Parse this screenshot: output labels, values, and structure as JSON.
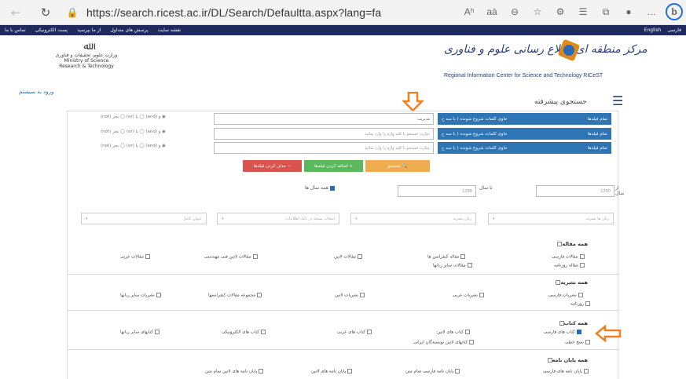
{
  "browser": {
    "url": "https://search.ricest.ac.ir/DL/Search/Defaultta.aspx?lang=fa",
    "zoom": "Aʰ",
    "read": "aà"
  },
  "topnav": {
    "left": [
      "تماس با ما",
      "پست الکترونیکی",
      "از ما بپرسید",
      "پرسش های متداول",
      "نقشه سایت"
    ],
    "right": [
      "English",
      "فارسی"
    ]
  },
  "header": {
    "center_fa": "مرکز منطقه ای اطلاع رسانی علوم و فناوری",
    "center_en": "Regional Information Center for Science and Technology  RICeST",
    "ministry_fa": "وزارت علوم، تحقیقات و فناوری",
    "ministry_en1": "Ministry of Science",
    "ministry_en2": "Research & Technology"
  },
  "login": "ورود به سیستم",
  "adv_title": "جستجوی پیشرفته",
  "rows": [
    {
      "field": "تمام فیلدها",
      "cond": "حاوی کلمات شروع شونده ( با سه ح",
      "text": "مدیریت",
      "bool": "(not) بجز ◯ (or) یا ◯ (and) و ◉"
    },
    {
      "field": "تمام فیلدها",
      "cond": "حاوی کلمات شروع شونده ( با سه ح",
      "text": "عبارت جستجو یا کلید واژه را وارد نمائید",
      "bool": "(not) بجز ◯ (or) یا ◯ (and) و ◉"
    },
    {
      "field": "تمام فیلدها",
      "cond": "حاوی کلمات شروع شونده ( با سه ح",
      "text": "عبارت جستجو یا کلید واژه را وارد نمائید",
      "bool": "(not) بجز ◯ (or) یا ◯ (and) و ◉"
    }
  ],
  "actions": {
    "search": "جستجو",
    "add": "اضافه کردن فیلدها",
    "remove": "حذف کردن فیلدها"
  },
  "years": {
    "from": "از سال",
    "from_val": "1350",
    "to": "تا سال",
    "to_val": "1398",
    "all": "همه سال ها"
  },
  "selects": [
    "زبان ها نشریه",
    "زبان نشریه",
    "انتخاب نسخه در بانک اطلاعات",
    "عنوان کامل"
  ],
  "sections": [
    {
      "title": "مقاله",
      "all": "همه",
      "opts": [
        [
          "مقالات فارسی",
          "مقاله کنفرانس ها",
          "مقالات لاتین",
          "مقالات لاتین فنی مهندسی",
          "مقالات عربی"
        ],
        [
          "مقاله روزنامه",
          "مقالات سایر زبانها"
        ]
      ]
    },
    {
      "title": "نشریه",
      "all": "همه",
      "opts": [
        [
          "نشریات فارسی",
          "نشریات عربی",
          "نشریات لاتین",
          "مجموعه مقالات کنفرانسها",
          "نشریات سایر زبانها"
        ],
        [
          "روزنامه"
        ]
      ]
    },
    {
      "title": "کتاب",
      "all": "همه",
      "opts": [
        [
          "کتاب های فارسی",
          "کتاب های لاتین",
          "کتاب های عربی",
          "کتاب های الکترونیکی",
          "کتابهای سایر زبانها"
        ],
        [
          "نسخ خطی",
          "کتابهای لاتین نویسندگان ایرانی"
        ]
      ]
    },
    {
      "title": "پایان نامه",
      "all": "همه",
      "opts": [
        [
          "پایان نامه های فارسی",
          "پایان نامه فارسی تمام متن",
          "پایان نامه های لاتین",
          "پایان نامه های لاتین تمام متن"
        ]
      ]
    }
  ]
}
